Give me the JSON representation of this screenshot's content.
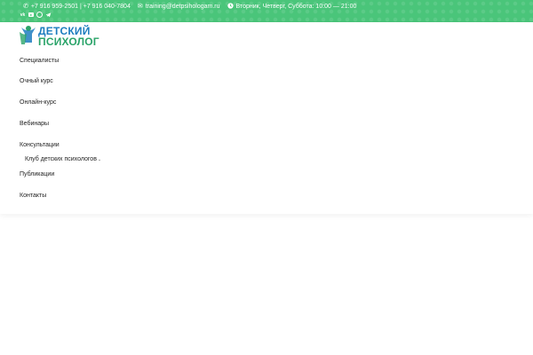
{
  "topbar": {
    "phone": "+7 916 959-2501 | +7 916 040-7804",
    "email": "training@detpsihologam.ru",
    "hours": "Вторник, Четверг, Суббота: 10:00 — 21:00",
    "icons": {
      "phone": "phone-icon",
      "email": "envelope-icon",
      "clock": "clock-icon"
    },
    "social": [
      "vk-icon",
      "youtube-icon",
      "whatsapp-icon",
      "telegram-icon"
    ],
    "social_glyphs": {
      "vk": "vk"
    },
    "color": "#4ac57a"
  },
  "logo": {
    "line1": "ДЕТСКИЙ",
    "line2": "ПСИХОЛОГ",
    "color1": "#1d7dbf",
    "color2": "#2ba46a"
  },
  "menu": {
    "items": [
      {
        "label": "Специалисты"
      },
      {
        "label": "Очный курс"
      },
      {
        "label": "Онлайн-курс"
      },
      {
        "label": "Вебинары"
      },
      {
        "label": "Консультации"
      }
    ],
    "submenu": {
      "label": "Клуб детских психологов"
    },
    "items_after": [
      {
        "label": "Публикации"
      },
      {
        "label": "Контакты"
      }
    ]
  }
}
